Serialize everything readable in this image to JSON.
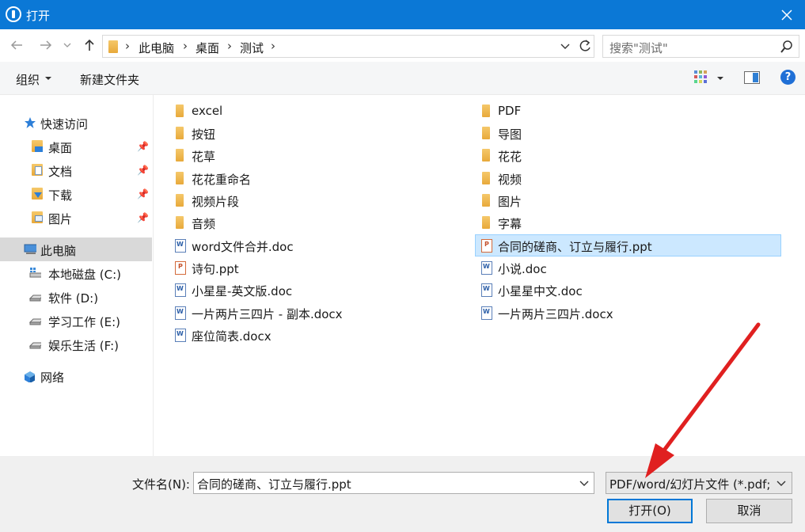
{
  "window": {
    "title": "打开"
  },
  "address": {
    "crumbs": [
      "此电脑",
      "桌面",
      "测试"
    ],
    "search_placeholder": "搜索\"测试\""
  },
  "toolbar": {
    "organize": "组织",
    "new_folder": "新建文件夹"
  },
  "nav": {
    "quick_access": "快速访问",
    "items": [
      {
        "label": "桌面",
        "icon": "desktop-folder-icon",
        "pinned": true
      },
      {
        "label": "文档",
        "icon": "documents-folder-icon",
        "pinned": true
      },
      {
        "label": "下载",
        "icon": "downloads-folder-icon",
        "pinned": true
      },
      {
        "label": "图片",
        "icon": "pictures-folder-icon",
        "pinned": true
      }
    ],
    "this_pc": "此电脑",
    "drives": [
      {
        "label": "本地磁盘 (C:)"
      },
      {
        "label": "软件 (D:)"
      },
      {
        "label": "学习工作 (E:)"
      },
      {
        "label": "娱乐生活 (F:)"
      }
    ],
    "network": "网络"
  },
  "files": {
    "col1": [
      {
        "name": "excel",
        "type": "folder"
      },
      {
        "name": "按钮",
        "type": "folder"
      },
      {
        "name": "花草",
        "type": "folder"
      },
      {
        "name": "花花重命名",
        "type": "folder"
      },
      {
        "name": "视频片段",
        "type": "folder"
      },
      {
        "name": "音频",
        "type": "folder"
      },
      {
        "name": "word文件合并.doc",
        "type": "doc"
      },
      {
        "name": "诗句.ppt",
        "type": "ppt"
      },
      {
        "name": "小星星-英文版.doc",
        "type": "doc"
      },
      {
        "name": "一片两片三四片 - 副本.docx",
        "type": "doc"
      },
      {
        "name": "座位简表.docx",
        "type": "doc"
      }
    ],
    "col2": [
      {
        "name": "PDF",
        "type": "folder"
      },
      {
        "name": "导图",
        "type": "folder"
      },
      {
        "name": "花花",
        "type": "folder"
      },
      {
        "name": "视频",
        "type": "folder"
      },
      {
        "name": "图片",
        "type": "folder"
      },
      {
        "name": "字幕",
        "type": "folder"
      },
      {
        "name": "合同的磋商、订立与履行.ppt",
        "type": "ppt",
        "selected": true
      },
      {
        "name": "小说.doc",
        "type": "doc"
      },
      {
        "name": "小星星中文.doc",
        "type": "doc"
      },
      {
        "name": "一片两片三四片.docx",
        "type": "doc"
      }
    ]
  },
  "bottom": {
    "filename_label": "文件名(N):",
    "filename_value": "合同的磋商、订立与履行.ppt",
    "filetype_value": "PDF/word/幻灯片文件 (*.pdf;",
    "open_button": "打开(O)",
    "cancel_button": "取消"
  },
  "colors": {
    "titlebar": "#0b78d6",
    "selection": "#cce8ff",
    "arrow": "#e02020"
  }
}
